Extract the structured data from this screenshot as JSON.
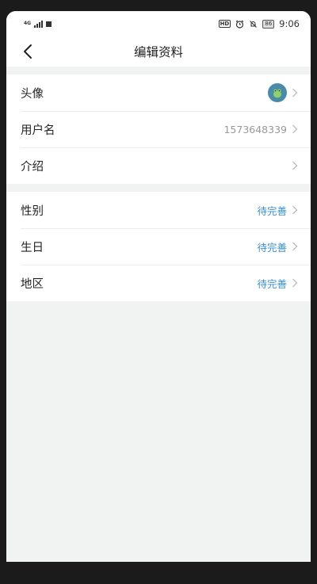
{
  "status_bar": {
    "network": "4G",
    "hd": "HD",
    "battery": "86",
    "time": "9:06"
  },
  "nav": {
    "title": "编辑资料"
  },
  "profile_group": [
    {
      "label": "头像",
      "value": ""
    },
    {
      "label": "用户名",
      "value": "1573648339"
    },
    {
      "label": "介绍",
      "value": ""
    }
  ],
  "info_group": [
    {
      "label": "性别",
      "value": "待完善"
    },
    {
      "label": "生日",
      "value": "待完善"
    },
    {
      "label": "地区",
      "value": "待完善"
    }
  ],
  "colors": {
    "pending": "#3a8fd0",
    "background": "#f1f2f2",
    "avatar": "#4a8ca8"
  },
  "icons": {
    "back": "chevron-left-icon",
    "row_arrow": "chevron-right-icon",
    "alarm": "alarm-icon",
    "mute": "mute-icon"
  }
}
